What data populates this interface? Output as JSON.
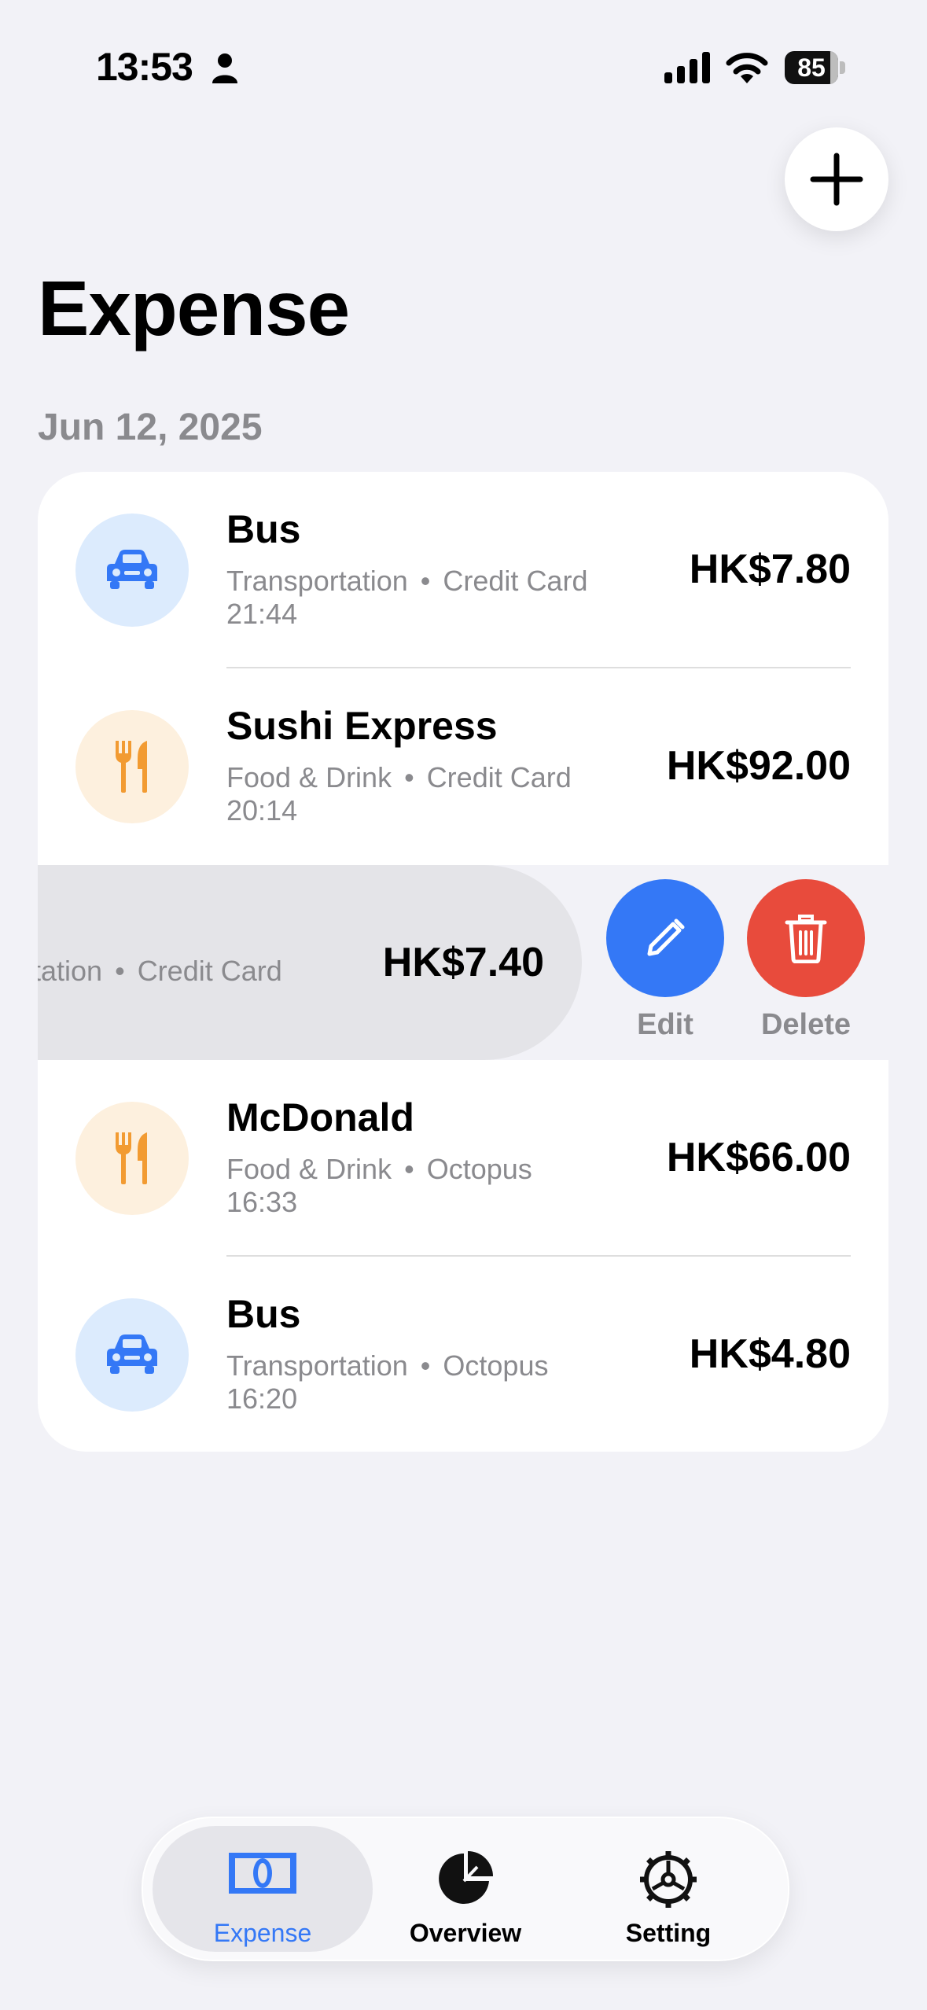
{
  "status_bar": {
    "time": "13:53",
    "battery": "85"
  },
  "header": {
    "title": "Expense",
    "add_icon": "plus-icon"
  },
  "section": {
    "date": "Jun 12, 2025"
  },
  "expenses": [
    {
      "title": "Bus",
      "category": "Transportation",
      "payment": "Credit Card",
      "time": "21:44",
      "amount": "HK$7.80",
      "icon": "car-icon"
    },
    {
      "title": "Sushi Express",
      "category": "Food & Drink",
      "payment": "Credit Card",
      "time": "20:14",
      "amount": "HK$92.00",
      "icon": "fork-knife-icon"
    },
    {
      "subtitle_partial": "tation",
      "payment": "Credit Card",
      "amount": "HK$7.40"
    },
    {
      "title": "McDonald",
      "category": "Food & Drink",
      "payment": "Octopus",
      "time": "16:33",
      "amount": "HK$66.00",
      "icon": "fork-knife-icon"
    },
    {
      "title": "Bus",
      "category": "Transportation",
      "payment": "Octopus",
      "time": "16:20",
      "amount": "HK$4.80",
      "icon": "car-icon"
    }
  ],
  "swipe_actions": {
    "edit": "Edit",
    "delete": "Delete"
  },
  "tabs": [
    {
      "label": "Expense",
      "icon": "banknote-icon",
      "active": true
    },
    {
      "label": "Overview",
      "icon": "pie-chart-icon",
      "active": false
    },
    {
      "label": "Setting",
      "icon": "gear-icon",
      "active": false
    }
  ],
  "colors": {
    "accent": "#3478f6",
    "delete": "#e84b3c",
    "food": "#f29b32"
  }
}
